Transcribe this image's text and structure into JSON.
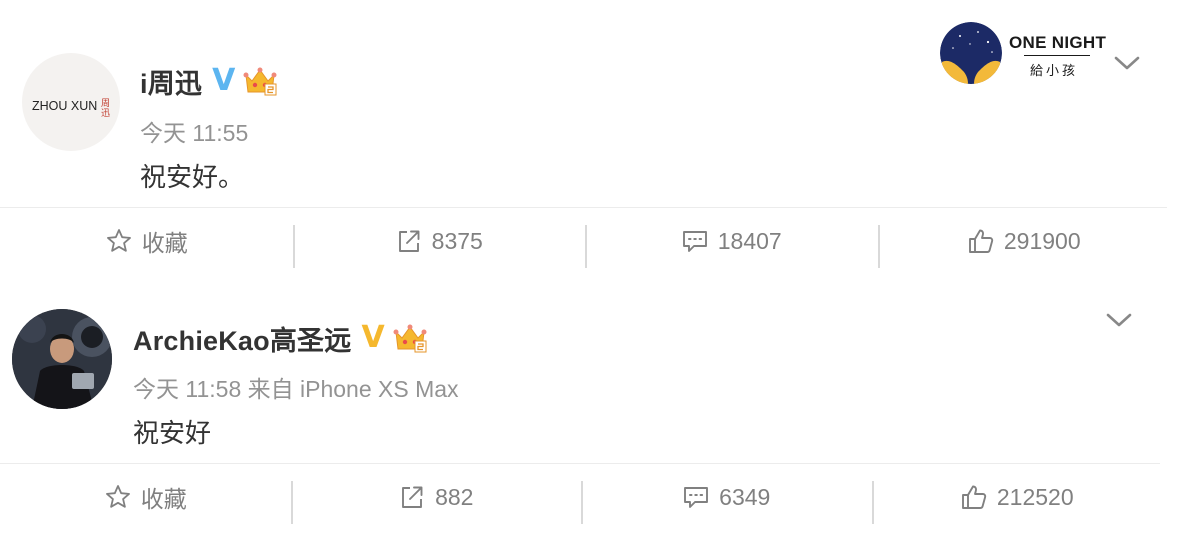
{
  "posts": [
    {
      "avatar_text": {
        "latin": "ZHOU XUN",
        "cn": "周迅"
      },
      "username": "i周迅",
      "verified_badge": "V",
      "verified_color": "#5cb5f0",
      "time": "今天 11:55",
      "content": "祝安好。",
      "actions": {
        "favorite_label": "收藏",
        "reposts": "8375",
        "comments": "18407",
        "likes": "291900"
      }
    },
    {
      "username": "ArchieKao高圣远",
      "verified_badge": "V",
      "verified_color": "#f5b82e",
      "time": "今天 11:58 来自 iPhone XS Max",
      "content": "祝安好",
      "actions": {
        "favorite_label": "收藏",
        "reposts": "882",
        "comments": "6349",
        "likes": "212520"
      }
    }
  ],
  "promo": {
    "title": "ONE NIGHT",
    "subtitle": "給小孩"
  },
  "icons": [
    "star-icon",
    "repost-icon",
    "comment-icon",
    "thumbs-up-icon",
    "chevron-down-icon",
    "crown-badge-icon"
  ]
}
